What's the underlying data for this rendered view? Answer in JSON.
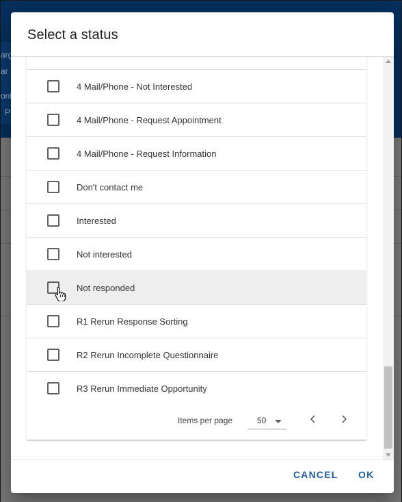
{
  "background": {
    "snippets": [
      "arg",
      "ar",
      "ont",
      "P"
    ]
  },
  "dialog": {
    "title": "Select a status",
    "options": [
      {
        "label": "4 Mail/Phone - Not Interested",
        "checked": false
      },
      {
        "label": "4 Mail/Phone - Request Appointment",
        "checked": false
      },
      {
        "label": "4 Mail/Phone - Request Information",
        "checked": false
      },
      {
        "label": "Don't contact me",
        "checked": false
      },
      {
        "label": "Interested",
        "checked": false
      },
      {
        "label": "Not interested",
        "checked": false
      },
      {
        "label": "Not responded",
        "checked": false,
        "hovered": true
      },
      {
        "label": "R1 Rerun Response Sorting",
        "checked": false
      },
      {
        "label": "R2 Rerun Incomplete Questionnaire",
        "checked": false
      },
      {
        "label": "R3 Rerun Immediate Opportunity",
        "checked": false
      }
    ],
    "paginator": {
      "items_per_page_label": "Items per page",
      "items_per_page_value": "50"
    },
    "actions": {
      "cancel_label": "CANCEL",
      "ok_label": "OK"
    }
  },
  "colors": {
    "header_bg": "#06305e",
    "accent": "#1f5b9b",
    "row_hover": "#eeeeee"
  },
  "icons": [
    "checkbox-icon",
    "chevron-left-icon",
    "chevron-right-icon",
    "dropdown-caret-icon",
    "hand-pointer-icon"
  ]
}
